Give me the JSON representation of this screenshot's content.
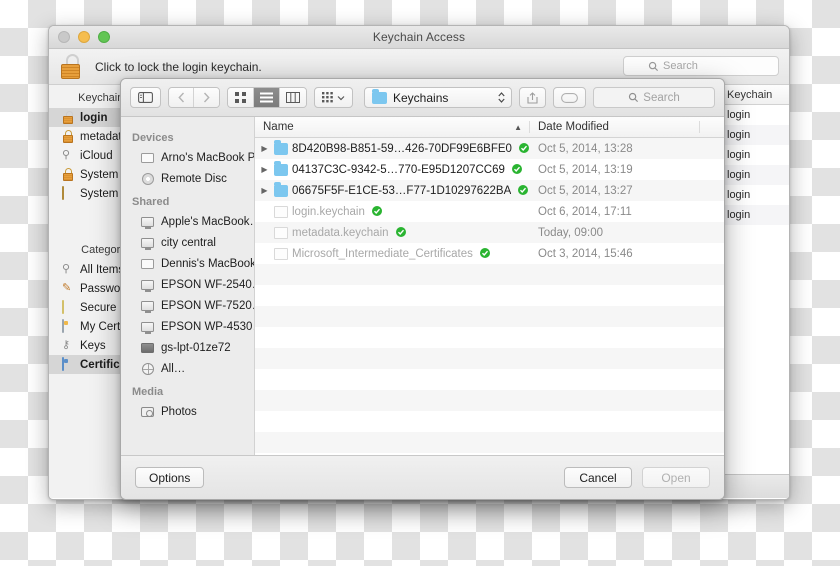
{
  "keychain_window": {
    "title": "Keychain Access",
    "lock_message": "Click to lock the login keychain.",
    "lock_icon": "padlock-open-icon",
    "search": {
      "placeholder": "Search",
      "icon": "search-icon"
    },
    "sidebar": {
      "keychains_header": "Keychains",
      "keychains": [
        {
          "label": "login",
          "icon": "lock-open-icon",
          "selected": true
        },
        {
          "label": "metadata",
          "icon": "lock-closed-icon",
          "selected": false
        },
        {
          "label": "iCloud",
          "icon": "keyring-icon",
          "selected": false
        },
        {
          "label": "System",
          "icon": "lock-closed-icon",
          "selected": false
        },
        {
          "label": "System Roots",
          "icon": "system-roots-icon",
          "selected": false
        }
      ],
      "category_header": "Category",
      "categories": [
        {
          "label": "All Items",
          "icon": "keyring-icon",
          "selected": false
        },
        {
          "label": "Passwords",
          "icon": "pen-icon",
          "selected": false
        },
        {
          "label": "Secure Notes",
          "icon": "note-icon",
          "selected": false
        },
        {
          "label": "My Certificates",
          "icon": "certificate-icon",
          "selected": false
        },
        {
          "label": "Keys",
          "icon": "key-icon",
          "selected": false
        },
        {
          "label": "Certificates",
          "icon": "certificate-blue-icon",
          "selected": true
        }
      ]
    },
    "table": {
      "columns": [
        "Keychain"
      ],
      "rows": [
        "login",
        "login",
        "login",
        "login",
        "login",
        "login"
      ]
    },
    "footer": {
      "icon": "info-button-icon"
    }
  },
  "open_dialog": {
    "toolbar": {
      "sidebar_toggle_icon": "sidebar-toggle-icon",
      "back_icon": "chevron-left-icon",
      "forward_icon": "chevron-right-icon",
      "view_icons": [
        "icon-view-icon",
        "list-view-icon",
        "column-view-icon"
      ],
      "view_active_index": 1,
      "arrange_icon": "arrange-grid-icon",
      "arrange_chevron_icon": "chevron-down-icon",
      "path_label": "Keychains",
      "path_folder_icon": "folder-icon",
      "path_stepper_icon": "up-down-stepper-icon",
      "share_icon": "share-icon",
      "tag_icon": "tag-icon",
      "search": {
        "placeholder": "Search",
        "icon": "search-icon"
      }
    },
    "sidebar": [
      {
        "group": "Devices",
        "items": [
          {
            "label": "Arno's MacBook Pro",
            "icon": "computer-icon"
          },
          {
            "label": "Remote Disc",
            "icon": "disc-icon"
          }
        ]
      },
      {
        "group": "Shared",
        "items": [
          {
            "label": "Apple's MacBook…",
            "icon": "shared-computer-icon"
          },
          {
            "label": "city central",
            "icon": "shared-computer-icon"
          },
          {
            "label": "Dennis's MacBook…",
            "icon": "computer-icon"
          },
          {
            "label": "EPSON WF-2540…",
            "icon": "shared-computer-icon"
          },
          {
            "label": "EPSON WF-7520…",
            "icon": "shared-computer-icon"
          },
          {
            "label": "EPSON WP-4530…",
            "icon": "shared-computer-icon"
          },
          {
            "label": "gs-lpt-01ze72",
            "icon": "shared-computer-dark-icon"
          },
          {
            "label": "All…",
            "icon": "globe-icon"
          }
        ]
      },
      {
        "group": "Media",
        "items": [
          {
            "label": "Photos",
            "icon": "camera-icon"
          }
        ]
      }
    ],
    "list": {
      "columns": {
        "name": "Name",
        "date_modified": "Date Modified",
        "sort_icon": "chevron-up-icon"
      },
      "rows": [
        {
          "disclosure": true,
          "kind": "folder",
          "name": "8D420B98-B851-59…426-70DF99E6BFE0",
          "badge": "green-check-icon",
          "date": "Oct 5, 2014, 13:28",
          "dim": false
        },
        {
          "disclosure": true,
          "kind": "folder",
          "name": "04137C3C-9342-5…770-E95D1207CC69",
          "badge": "green-check-icon",
          "date": "Oct 5, 2014, 13:19",
          "dim": false
        },
        {
          "disclosure": true,
          "kind": "folder",
          "name": "06675F5F-E1CE-53…F77-1D10297622BA",
          "badge": "green-check-icon",
          "date": "Oct 5, 2014, 13:27",
          "dim": false
        },
        {
          "disclosure": false,
          "kind": "document",
          "name": "login.keychain",
          "badge": "green-check-icon",
          "date": "Oct 6, 2014, 17:11",
          "dim": true
        },
        {
          "disclosure": false,
          "kind": "document",
          "name": "metadata.keychain",
          "badge": "green-check-icon",
          "date": "Today, 09:00",
          "dim": true
        },
        {
          "disclosure": false,
          "kind": "document",
          "name": "Microsoft_Intermediate_Certificates",
          "badge": "green-check-icon",
          "date": "Oct 3, 2014, 15:46",
          "dim": true
        }
      ]
    },
    "footer": {
      "options_label": "Options",
      "cancel_label": "Cancel",
      "open_label": "Open",
      "open_disabled": true
    }
  },
  "colors": {
    "folder_blue": "#7cc7ef",
    "badge_green": "#2ab431",
    "selection_gray": "#d6d6d6"
  }
}
